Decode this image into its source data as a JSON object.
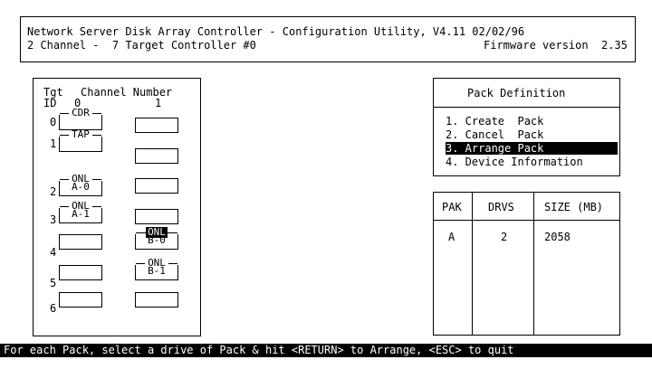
{
  "header": {
    "line1": "Network Server Disk Array Controller - Configuration Utility, V4.11 02/02/96",
    "line2_left": "2 Channel -  7 Target Controller #0",
    "line2_right": "Firmware version  2.35"
  },
  "grid": {
    "head_tgt": "Tgt",
    "head_id": "ID",
    "head_channel_number": "Channel Number",
    "ch0": "0",
    "ch1": "1",
    "rows": [
      {
        "id": "0",
        "c0": "CDR",
        "c0sub": "",
        "c1": "",
        "c1sub": ""
      },
      {
        "id": "1",
        "c0": "TAP",
        "c0sub": "",
        "c1": "",
        "c1sub": ""
      },
      {
        "id": "2",
        "c0": "ONL",
        "c0sub": "A-0",
        "c1": "",
        "c1sub": ""
      },
      {
        "id": "3",
        "c0": "ONL",
        "c0sub": "A-1",
        "c1": "",
        "c1sub": ""
      },
      {
        "id": "4",
        "c0": "",
        "c0sub": "",
        "c1": "ONL",
        "c1sub": "B-0"
      },
      {
        "id": "5",
        "c0": "",
        "c0sub": "",
        "c1": "ONL",
        "c1sub": "B-1"
      },
      {
        "id": "6",
        "c0": "",
        "c0sub": "",
        "c1": "",
        "c1sub": ""
      }
    ]
  },
  "menu": {
    "title": "Pack Definition",
    "items": [
      "1. Create  Pack",
      "2. Cancel  Pack",
      "3. Arrange Pack",
      "4. Device Information"
    ],
    "selected_index": 2
  },
  "pack_table": {
    "headers": [
      "PAK",
      "DRVS",
      "SIZE (MB)"
    ],
    "rows": [
      [
        "A",
        "2",
        "2058"
      ]
    ]
  },
  "status_bar": "For each Pack, select a drive of Pack & hit <RETURN> to Arrange, <ESC> to quit"
}
